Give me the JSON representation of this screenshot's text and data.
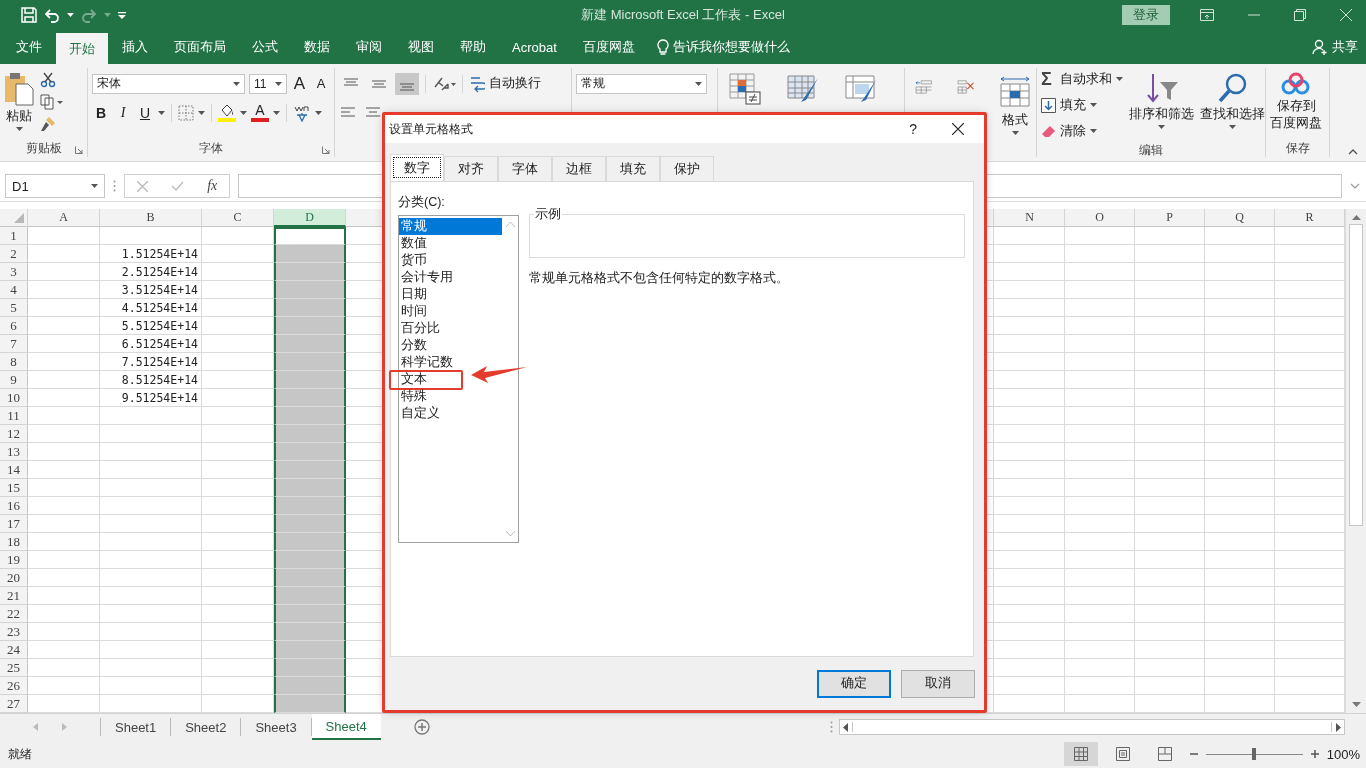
{
  "title_bar": {
    "title": "新建 Microsoft Excel 工作表 - Excel",
    "sign_in": "登录",
    "redo_disabled": true
  },
  "ribbon_tabs": [
    {
      "label": "文件",
      "selected": false
    },
    {
      "label": "开始",
      "selected": true
    },
    {
      "label": "插入",
      "selected": false
    },
    {
      "label": "页面布局",
      "selected": false
    },
    {
      "label": "公式",
      "selected": false
    },
    {
      "label": "数据",
      "selected": false
    },
    {
      "label": "审阅",
      "selected": false
    },
    {
      "label": "视图",
      "selected": false
    },
    {
      "label": "帮助",
      "selected": false
    },
    {
      "label": "Acrobat",
      "selected": false
    },
    {
      "label": "百度网盘",
      "selected": false
    }
  ],
  "tell_me": "告诉我你想要做什么",
  "share": "共享",
  "ribbon": {
    "paste": "粘贴",
    "clipboard_label": "剪贴板",
    "font_name": "宋体",
    "font_size": "11",
    "grow_font": "A",
    "shrink_font": "A",
    "bold": "B",
    "italic": "I",
    "underline": "U",
    "font_color": "A",
    "font_label": "字体",
    "vertical_align": [
      {
        "kind": "top",
        "selected": false
      },
      {
        "kind": "middle",
        "selected": false
      },
      {
        "kind": "bottom",
        "selected": true
      }
    ],
    "wrap_text": "自动换行",
    "number_format": "常规",
    "format": "格式",
    "autosum_symbol": "Σ",
    "autosum": "自动求和",
    "fill": "填充",
    "clear": "清除",
    "sort_filter": "排序和筛选",
    "find_select": "查找和选择",
    "editing_label": "编辑",
    "save_to": "保存到",
    "save_to_line2": "百度网盘",
    "save_label": "保存"
  },
  "formula_bar": {
    "name_box": "D1",
    "fx": "fx"
  },
  "sheet": {
    "columns_left": [
      {
        "label": "A",
        "selected": false
      },
      {
        "label": "B",
        "selected": false
      },
      {
        "label": "C",
        "selected": false
      },
      {
        "label": "D",
        "selected": true
      }
    ],
    "columns_right": [
      {
        "label": "N",
        "selected": false
      },
      {
        "label": "O",
        "selected": false
      },
      {
        "label": "P",
        "selected": false
      },
      {
        "label": "Q",
        "selected": false
      },
      {
        "label": "R",
        "selected": false
      }
    ],
    "rows": [
      {
        "number": "1",
        "active": true
      },
      {
        "number": "2",
        "active": false,
        "b": "1.51254E+14"
      },
      {
        "number": "3",
        "active": false,
        "b": "2.51254E+14"
      },
      {
        "number": "4",
        "active": false,
        "b": "3.51254E+14"
      },
      {
        "number": "5",
        "active": false,
        "b": "4.51254E+14"
      },
      {
        "number": "6",
        "active": false,
        "b": "5.51254E+14"
      },
      {
        "number": "7",
        "active": false,
        "b": "6.51254E+14"
      },
      {
        "number": "8",
        "active": false,
        "b": "7.51254E+14"
      },
      {
        "number": "9",
        "active": false,
        "b": "8.51254E+14"
      },
      {
        "number": "10",
        "active": false,
        "b": "9.51254E+14"
      },
      {
        "number": "11",
        "active": false
      },
      {
        "number": "12",
        "active": false
      },
      {
        "number": "13",
        "active": false
      },
      {
        "number": "14",
        "active": false
      },
      {
        "number": "15",
        "active": false
      },
      {
        "number": "16",
        "active": false
      },
      {
        "number": "17",
        "active": false
      },
      {
        "number": "18",
        "active": false
      },
      {
        "number": "19",
        "active": false
      },
      {
        "number": "20",
        "active": false
      },
      {
        "number": "21",
        "active": false
      },
      {
        "number": "22",
        "active": false
      },
      {
        "number": "23",
        "active": false
      },
      {
        "number": "24",
        "active": false
      },
      {
        "number": "25",
        "active": false
      },
      {
        "number": "26",
        "active": false
      },
      {
        "number": "27",
        "active": false
      }
    ]
  },
  "sheet_tabs": [
    {
      "label": "Sheet1",
      "selected": false
    },
    {
      "label": "Sheet2",
      "selected": false
    },
    {
      "label": "Sheet3",
      "selected": false
    },
    {
      "label": "Sheet4",
      "selected": true
    }
  ],
  "status_bar": {
    "status": "就绪",
    "views": [
      {
        "kind": "normal",
        "selected": true
      },
      {
        "kind": "layout",
        "selected": false
      },
      {
        "kind": "break",
        "selected": false
      }
    ],
    "zoom": {
      "level": 0.5,
      "reading": "100%"
    }
  },
  "dialog": {
    "title": "设置单元格格式",
    "help": "?",
    "tabs": [
      {
        "label": "数字",
        "selected": true
      },
      {
        "label": "对齐",
        "selected": false
      },
      {
        "label": "字体",
        "selected": false
      },
      {
        "label": "边框",
        "selected": false
      },
      {
        "label": "填充",
        "selected": false
      },
      {
        "label": "保护",
        "selected": false
      }
    ],
    "category_label": "分类(C):",
    "categories": [
      {
        "label": "常规",
        "selected": true,
        "annotated": false
      },
      {
        "label": "数值",
        "selected": false,
        "annotated": false
      },
      {
        "label": "货币",
        "selected": false,
        "annotated": false
      },
      {
        "label": "会计专用",
        "selected": false,
        "annotated": false
      },
      {
        "label": "日期",
        "selected": false,
        "annotated": false
      },
      {
        "label": "时间",
        "selected": false,
        "annotated": false
      },
      {
        "label": "百分比",
        "selected": false,
        "annotated": false
      },
      {
        "label": "分数",
        "selected": false,
        "annotated": false
      },
      {
        "label": "科学记数",
        "selected": false,
        "annotated": false
      },
      {
        "label": "文本",
        "selected": false,
        "annotated": true
      },
      {
        "label": "特殊",
        "selected": false,
        "annotated": false
      },
      {
        "label": "自定义",
        "selected": false,
        "annotated": false
      }
    ],
    "sample_label": "示例",
    "description": "常规单元格格式不包含任何特定的数字格式。",
    "buttons": [
      {
        "label": "确定",
        "default": true
      },
      {
        "label": "取消",
        "default": false
      }
    ]
  }
}
